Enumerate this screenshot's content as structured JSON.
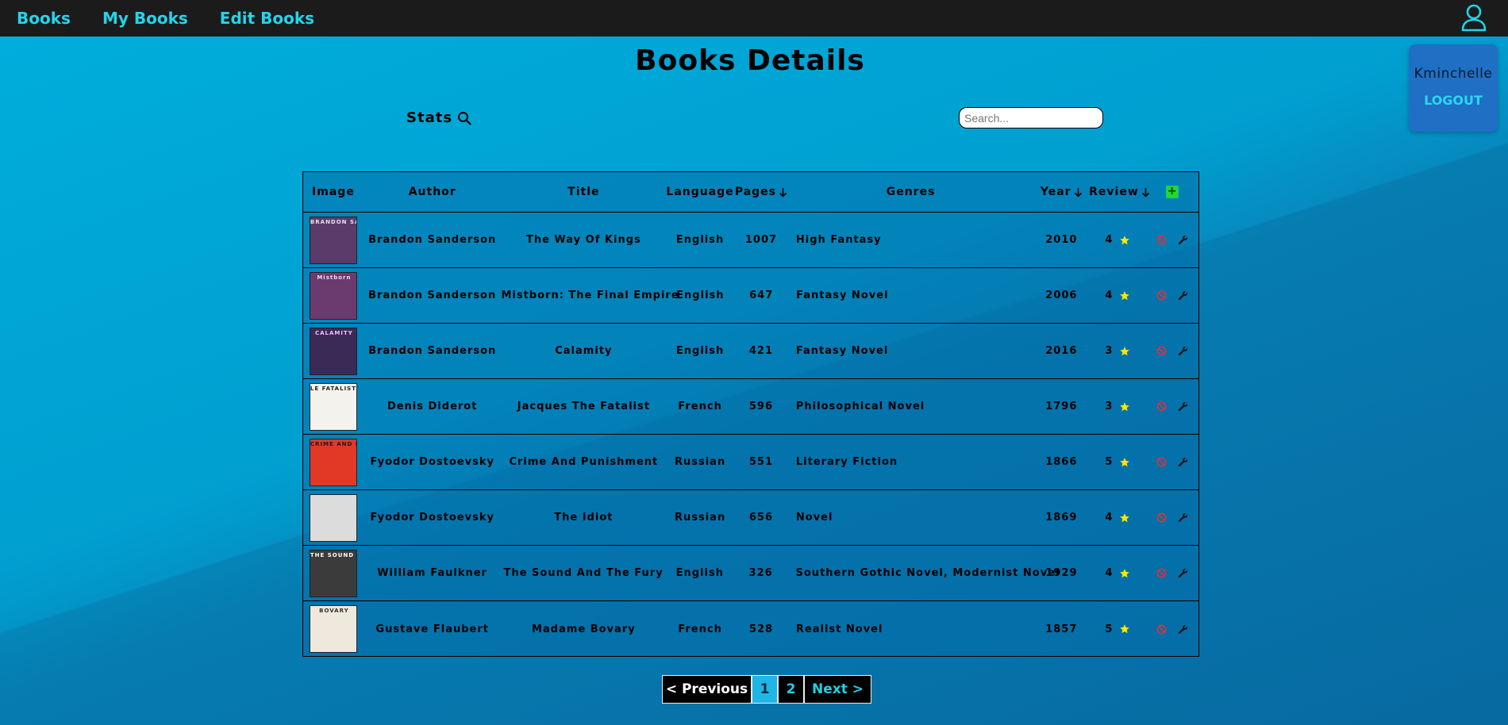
{
  "nav": {
    "books": "Books",
    "my_books": "My Books",
    "edit_books": "Edit Books"
  },
  "user": {
    "name": "Kminchelle",
    "logout": "LOGOUT"
  },
  "page": {
    "title": "Books Details",
    "stats_label": "Stats"
  },
  "search": {
    "placeholder": "Search..."
  },
  "table": {
    "headers": {
      "image": "Image",
      "author": "Author",
      "title": "Title",
      "language": "Language",
      "pages": "Pages",
      "genres": "Genres",
      "year": "Year",
      "review": "Review"
    },
    "rows": [
      {
        "author": "Brandon Sanderson",
        "title": "The Way Of Kings",
        "language": "English",
        "pages": "1007",
        "genres": "High Fantasy",
        "year": "2010",
        "review": "4",
        "cover_text": "BRANDON SANDERSON",
        "cover_bg": "#5a3b6a",
        "cover_fg": "#e6e1ee"
      },
      {
        "author": "Brandon Sanderson",
        "title": "Mistborn: The Final Empire",
        "language": "English",
        "pages": "647",
        "genres": "Fantasy Novel",
        "year": "2006",
        "review": "4",
        "cover_text": "Mistborn",
        "cover_bg": "#6b3a6f",
        "cover_fg": "#f0d6f0"
      },
      {
        "author": "Brandon Sanderson",
        "title": "Calamity",
        "language": "English",
        "pages": "421",
        "genres": "Fantasy Novel",
        "year": "2016",
        "review": "3",
        "cover_text": "CALAMITY",
        "cover_bg": "#3a2a55",
        "cover_fg": "#f3c0ff"
      },
      {
        "author": "Denis Diderot",
        "title": "Jacques The Fatalist",
        "language": "French",
        "pages": "596",
        "genres": "Philosophical Novel",
        "year": "1796",
        "review": "3",
        "cover_text": "LE FATALISTE",
        "cover_bg": "#f4f2ec",
        "cover_fg": "#222222"
      },
      {
        "author": "Fyodor Dostoevsky",
        "title": "Crime And Punishment",
        "language": "Russian",
        "pages": "551",
        "genres": "Literary Fiction",
        "year": "1866",
        "review": "5",
        "cover_text": "CRIME AND PUNISH MENT",
        "cover_bg": "#e23826",
        "cover_fg": "#1a1a1a"
      },
      {
        "author": "Fyodor Dostoevsky",
        "title": "The Idiot",
        "language": "Russian",
        "pages": "656",
        "genres": "Novel",
        "year": "1869",
        "review": "4",
        "cover_text": "",
        "cover_bg": "#dcdcdc",
        "cover_fg": "#888888"
      },
      {
        "author": "William Faulkner",
        "title": "The Sound And The Fury",
        "language": "English",
        "pages": "326",
        "genres": "Southern Gothic Novel, Modernist Novel",
        "year": "1929",
        "review": "4",
        "cover_text": "THE SOUND AND THE FURY",
        "cover_bg": "#3b3b3b",
        "cover_fg": "#ffffff"
      },
      {
        "author": "Gustave Flaubert",
        "title": "Madame Bovary",
        "language": "French",
        "pages": "528",
        "genres": "Realist Novel",
        "year": "1857",
        "review": "5",
        "cover_text": "BOVARY",
        "cover_bg": "#eee9dc",
        "cover_fg": "#333333"
      }
    ]
  },
  "pagination": {
    "prev": "< Previous",
    "pages": [
      "1",
      "2"
    ],
    "next": "Next >"
  },
  "colors": {
    "nav_bg": "#1b1b1b",
    "nav_link": "#22d5ea",
    "star": "#ffe600",
    "delete": "#d63344",
    "add": "#1fd63b"
  },
  "icons": {
    "user": "user-icon",
    "search": "search-icon",
    "sort": "arrow-down-icon",
    "star": "star-icon",
    "delete": "ban-icon",
    "edit": "wrench-icon",
    "add": "plus-icon"
  }
}
